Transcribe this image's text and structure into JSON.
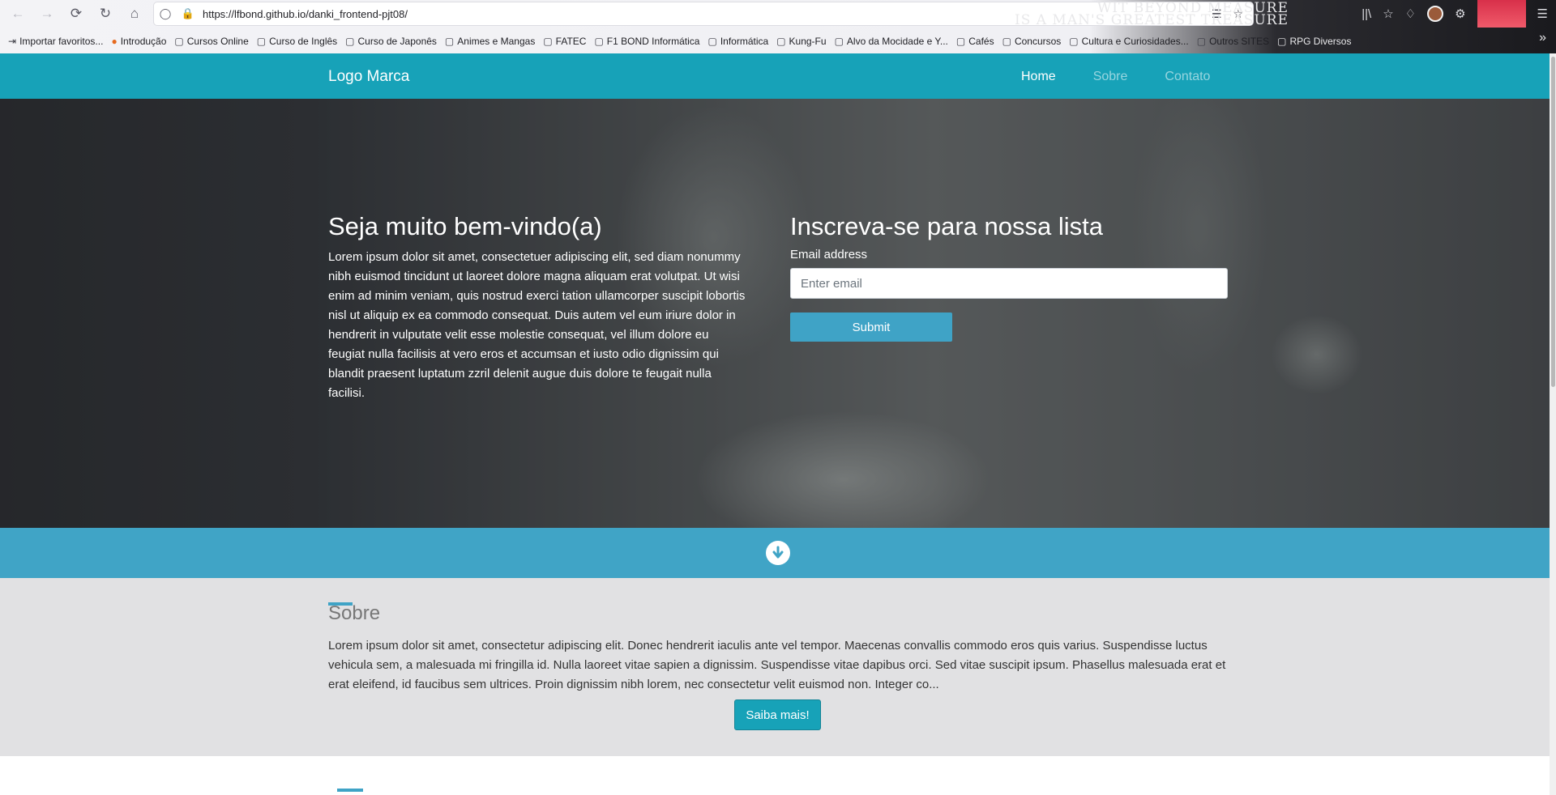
{
  "browser": {
    "url": "https://lfbond.github.io/danki_frontend-pjt08/",
    "banner_line1": "WIT BEYOND MEASURE",
    "banner_line2": "IS A MAN'S GREATEST TREASURE",
    "bookmarks": [
      {
        "label": "Importar favoritos...",
        "icon": "import-icon"
      },
      {
        "label": "Introdução",
        "icon": "firefox-icon"
      },
      {
        "label": "Cursos Online",
        "icon": "folder-icon"
      },
      {
        "label": "Curso de Inglês",
        "icon": "folder-icon"
      },
      {
        "label": "Curso de Japonês",
        "icon": "folder-icon"
      },
      {
        "label": "Animes e Mangas",
        "icon": "folder-icon"
      },
      {
        "label": "FATEC",
        "icon": "folder-icon"
      },
      {
        "label": "F1 BOND Informática",
        "icon": "folder-icon"
      },
      {
        "label": "Informática",
        "icon": "folder-icon"
      },
      {
        "label": "Kung-Fu",
        "icon": "folder-icon"
      },
      {
        "label": "Alvo da Mocidade e Y...",
        "icon": "folder-icon"
      },
      {
        "label": "Cafés",
        "icon": "folder-icon"
      },
      {
        "label": "Concursos",
        "icon": "folder-icon"
      },
      {
        "label": "Cultura e Curiosidades...",
        "icon": "folder-icon"
      },
      {
        "label": "Outros SITES",
        "icon": "folder-icon"
      },
      {
        "label": "RPG Diversos",
        "icon": "folder-icon"
      }
    ]
  },
  "site": {
    "logo": "Logo Marca",
    "menu": [
      {
        "label": "Home",
        "active": true
      },
      {
        "label": "Sobre",
        "active": false
      },
      {
        "label": "Contato",
        "active": false
      }
    ]
  },
  "hero": {
    "title": "Seja muito bem-vindo(a)",
    "text": "Lorem ipsum dolor sit amet, consectetuer adipiscing elit, sed diam nonummy nibh euismod tincidunt ut laoreet dolore magna aliquam erat volutpat. Ut wisi enim ad minim veniam, quis nostrud exerci tation ullamcorper suscipit lobortis nisl ut aliquip ex ea commodo consequat. Duis autem vel eum iriure dolor in hendrerit in vulputate velit esse molestie consequat, vel illum dolore eu feugiat nulla facilisis at vero eros et accumsan et iusto odio dignissim qui blandit praesent luptatum zzril delenit augue duis dolore te feugait nulla facilisi.",
    "form_title": "Inscreva-se para nossa lista",
    "email_label": "Email address",
    "email_placeholder": "Enter email",
    "submit_label": "Submit"
  },
  "sobre": {
    "title": "Sobre",
    "text": "Lorem ipsum dolor sit amet, consectetur adipiscing elit. Donec hendrerit iaculis ante vel tempor. Maecenas convallis commodo eros quis varius. Suspendisse luctus vehicula sem, a malesuada mi fringilla id. Nulla laoreet vitae sapien a dignissim. Suspendisse vitae dapibus orci. Sed vitae suscipit ipsum. Phasellus malesuada erat et erat eleifend, id faucibus sem ultrices. Proin dignissim nibh lorem, nec consectetur velit euismod non. Integer co...",
    "button_label": "Saiba mais!"
  },
  "colors": {
    "navbar": "#17a2b8",
    "accent": "#40a4c6",
    "section_bg": "#e1e1e3"
  }
}
